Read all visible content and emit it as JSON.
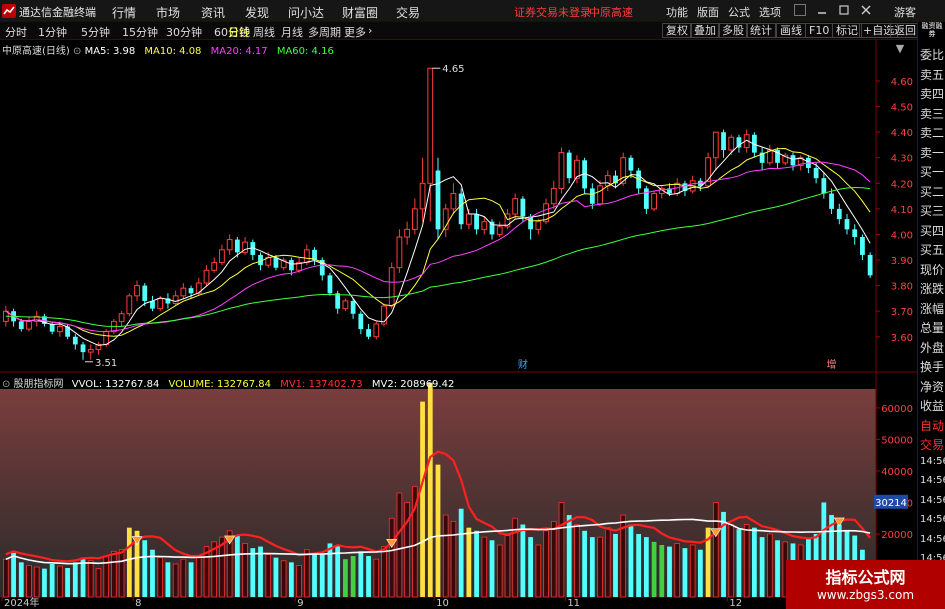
{
  "menubar": {
    "app_title": "通达信金融终端",
    "items": [
      "行情",
      "市场",
      "资讯",
      "发现",
      "问小达",
      "财富圈",
      "交易"
    ],
    "notice": "证券交易未登录",
    "stock_name": "中原高速",
    "right_items": [
      "功能",
      "版面",
      "公式",
      "选项"
    ],
    "guest": "游客"
  },
  "toolbar": {
    "periods": [
      "分时",
      "1分钟",
      "5分钟",
      "15分钟",
      "30分钟",
      "60分钟",
      "日线",
      "周线",
      "月线",
      "多周期",
      "更多"
    ],
    "active_period": "日线",
    "buttons": [
      "复权",
      "叠加",
      "多股",
      "统计",
      "画线",
      "F10",
      "标记",
      "+自选",
      "返回"
    ]
  },
  "right_panel": {
    "icon_text": "融资融券",
    "items": [
      "委比",
      "卖五",
      "卖四",
      "卖三",
      "卖二",
      "卖一",
      "买一",
      "买二",
      "买三",
      "买四",
      "买五",
      "现价",
      "涨跌",
      "涨幅",
      "总量",
      "外盘",
      "换手",
      "净资",
      "收益",
      "自动",
      "交易",
      "14:56",
      "14:56",
      "14:56",
      "14:56",
      "14:56",
      "14:56",
      "14:56"
    ]
  },
  "price_info": {
    "title": "中原高速(日线)",
    "ma5": "MA5: 3.98",
    "ma10": "MA10: 4.08",
    "ma20": "MA20: 4.17",
    "ma60": "MA60: 4.16",
    "high_label": "4.65",
    "low_label": "3.51",
    "event_1": "财",
    "event_2": "增"
  },
  "volume_info": {
    "title": "股朋指标网",
    "vvol": "VVOL: 132767.84",
    "volume": "VOLUME: 132767.84",
    "mv1": "MV1: 137402.73",
    "mv2": "MV2: 208969.42",
    "current_marker": "30214"
  },
  "colors": {
    "up": "#ff3c3c",
    "down": "#54ffff",
    "ma5": "#ffffff",
    "ma10": "#ffff40",
    "ma20": "#ff40ff",
    "ma60": "#40ff40",
    "mv1": "#ff2020",
    "mv2": "#ffffff"
  },
  "chart_data": {
    "type": "candlestick",
    "xlabels": [
      {
        "i": 0,
        "label": "2024年"
      },
      {
        "i": 17,
        "label": "8"
      },
      {
        "i": 38,
        "label": "9"
      },
      {
        "i": 56,
        "label": "10"
      },
      {
        "i": 73,
        "label": "11"
      },
      {
        "i": 94,
        "label": "12"
      }
    ],
    "price_ticks": [
      4.6,
      4.5,
      4.4,
      4.3,
      4.2,
      4.1,
      4.0,
      3.9,
      3.8,
      3.7,
      3.6
    ],
    "price_ylim": [
      3.47,
      4.69
    ],
    "volume_ticks": [
      60000,
      50000,
      40000,
      30000,
      20000,
      10000
    ],
    "volume_ylim": [
      0,
      66000
    ],
    "bars": [
      [
        3.66,
        3.7,
        3.72,
        3.64,
        12000
      ],
      [
        3.7,
        3.66,
        3.71,
        3.64,
        14000
      ],
      [
        3.66,
        3.63,
        3.67,
        3.62,
        11000
      ],
      [
        3.63,
        3.66,
        3.68,
        3.62,
        10000
      ],
      [
        3.66,
        3.68,
        3.7,
        3.64,
        9500
      ],
      [
        3.68,
        3.65,
        3.69,
        3.64,
        9000
      ],
      [
        3.65,
        3.62,
        3.66,
        3.61,
        10500
      ],
      [
        3.62,
        3.64,
        3.66,
        3.6,
        9800
      ],
      [
        3.64,
        3.6,
        3.65,
        3.59,
        9200
      ],
      [
        3.6,
        3.57,
        3.61,
        3.55,
        11000
      ],
      [
        3.57,
        3.54,
        3.58,
        3.51,
        12500
      ],
      [
        3.54,
        3.55,
        3.57,
        3.51,
        11500
      ],
      [
        3.55,
        3.57,
        3.58,
        3.53,
        9000
      ],
      [
        3.57,
        3.62,
        3.63,
        3.56,
        13000
      ],
      [
        3.62,
        3.66,
        3.67,
        3.61,
        14500
      ],
      [
        3.66,
        3.69,
        3.7,
        3.64,
        15000
      ],
      [
        3.69,
        3.76,
        3.77,
        3.68,
        22000
      ],
      [
        3.76,
        3.8,
        3.82,
        3.74,
        21000
      ],
      [
        3.8,
        3.74,
        3.81,
        3.72,
        18000
      ],
      [
        3.74,
        3.71,
        3.76,
        3.7,
        15000
      ],
      [
        3.71,
        3.75,
        3.76,
        3.7,
        12500
      ],
      [
        3.75,
        3.73,
        3.77,
        3.71,
        11000
      ],
      [
        3.73,
        3.76,
        3.78,
        3.72,
        10500
      ],
      [
        3.76,
        3.79,
        3.81,
        3.75,
        12000
      ],
      [
        3.79,
        3.77,
        3.8,
        3.75,
        11000
      ],
      [
        3.77,
        3.81,
        3.83,
        3.76,
        13000
      ],
      [
        3.81,
        3.86,
        3.88,
        3.8,
        16000
      ],
      [
        3.86,
        3.89,
        3.91,
        3.85,
        17500
      ],
      [
        3.89,
        3.94,
        3.96,
        3.88,
        19000
      ],
      [
        3.94,
        3.98,
        4.0,
        3.92,
        21000
      ],
      [
        3.98,
        3.93,
        3.99,
        3.91,
        19500
      ],
      [
        3.93,
        3.97,
        3.99,
        3.92,
        17000
      ],
      [
        3.97,
        3.92,
        3.98,
        3.9,
        15500
      ],
      [
        3.92,
        3.88,
        3.93,
        3.86,
        16000
      ],
      [
        3.88,
        3.91,
        3.93,
        3.87,
        13500
      ],
      [
        3.91,
        3.87,
        3.92,
        3.86,
        12500
      ],
      [
        3.87,
        3.9,
        3.91,
        3.86,
        11500
      ],
      [
        3.9,
        3.86,
        3.91,
        3.84,
        11000
      ],
      [
        3.86,
        3.89,
        3.91,
        3.85,
        10000
      ],
      [
        3.89,
        3.94,
        3.96,
        3.88,
        15000
      ],
      [
        3.94,
        3.9,
        3.95,
        3.88,
        14000
      ],
      [
        3.9,
        3.84,
        3.91,
        3.82,
        13500
      ],
      [
        3.84,
        3.77,
        3.85,
        3.76,
        17000
      ],
      [
        3.77,
        3.71,
        3.78,
        3.69,
        16500
      ],
      [
        3.71,
        3.74,
        3.75,
        3.7,
        12000
      ],
      [
        3.74,
        3.69,
        3.75,
        3.67,
        13000
      ],
      [
        3.69,
        3.63,
        3.7,
        3.61,
        14500
      ],
      [
        3.63,
        3.6,
        3.65,
        3.59,
        13000
      ],
      [
        3.6,
        3.65,
        3.66,
        3.59,
        12000
      ],
      [
        3.65,
        3.72,
        3.73,
        3.64,
        16000
      ],
      [
        3.72,
        3.87,
        3.89,
        3.71,
        25000
      ],
      [
        3.87,
        3.99,
        4.02,
        3.85,
        33000
      ],
      [
        3.99,
        4.02,
        4.05,
        3.96,
        30000
      ],
      [
        4.02,
        4.1,
        4.14,
        4.0,
        35000
      ],
      [
        4.1,
        4.2,
        4.3,
        4.05,
        62000
      ],
      [
        4.2,
        4.65,
        4.65,
        4.05,
        68000
      ],
      [
        4.25,
        4.02,
        4.3,
        3.98,
        42000
      ],
      [
        4.02,
        4.1,
        4.12,
        3.99,
        26000
      ],
      [
        4.1,
        4.16,
        4.2,
        4.08,
        24000
      ],
      [
        4.16,
        4.04,
        4.18,
        4.02,
        28000
      ],
      [
        4.04,
        4.08,
        4.1,
        4.02,
        22000
      ],
      [
        4.08,
        4.02,
        4.1,
        4.0,
        21000
      ],
      [
        4.02,
        4.05,
        4.07,
        4.0,
        19000
      ],
      [
        4.05,
        4.0,
        4.06,
        3.98,
        18000
      ],
      [
        4.0,
        4.03,
        4.05,
        3.99,
        16500
      ],
      [
        4.03,
        4.08,
        4.1,
        4.02,
        19500
      ],
      [
        4.08,
        4.14,
        4.16,
        4.06,
        25000
      ],
      [
        4.14,
        4.07,
        4.15,
        4.05,
        23000
      ],
      [
        4.07,
        4.02,
        4.08,
        3.98,
        19000
      ],
      [
        4.02,
        4.05,
        4.06,
        4.0,
        16500
      ],
      [
        4.05,
        4.12,
        4.14,
        4.04,
        21000
      ],
      [
        4.12,
        4.18,
        4.21,
        4.1,
        24000
      ],
      [
        4.18,
        4.32,
        4.34,
        4.16,
        30000
      ],
      [
        4.32,
        4.22,
        4.33,
        4.2,
        26000
      ],
      [
        4.22,
        4.29,
        4.31,
        4.2,
        23000
      ],
      [
        4.29,
        4.18,
        4.3,
        4.16,
        21000
      ],
      [
        4.18,
        4.12,
        4.2,
        4.1,
        19000
      ],
      [
        4.12,
        4.19,
        4.21,
        4.11,
        19000
      ],
      [
        4.19,
        4.23,
        4.25,
        4.17,
        22000
      ],
      [
        4.23,
        4.2,
        4.25,
        4.18,
        20000
      ],
      [
        4.2,
        4.3,
        4.32,
        4.19,
        26000
      ],
      [
        4.3,
        4.25,
        4.31,
        4.22,
        23000
      ],
      [
        4.25,
        4.18,
        4.26,
        4.16,
        20000
      ],
      [
        4.18,
        4.1,
        4.19,
        4.08,
        19000
      ],
      [
        4.1,
        4.16,
        4.17,
        4.09,
        17500
      ],
      [
        4.16,
        4.18,
        4.19,
        4.14,
        16500
      ],
      [
        4.18,
        4.16,
        4.2,
        4.15,
        16000
      ],
      [
        4.16,
        4.2,
        4.22,
        4.15,
        17000
      ],
      [
        4.2,
        4.17,
        4.21,
        4.15,
        15500
      ],
      [
        4.17,
        4.21,
        4.23,
        4.16,
        16500
      ],
      [
        4.21,
        4.19,
        4.22,
        4.17,
        15000
      ],
      [
        4.19,
        4.3,
        4.32,
        4.18,
        22000
      ],
      [
        4.3,
        4.4,
        4.4,
        4.25,
        30000
      ],
      [
        4.4,
        4.33,
        4.41,
        4.3,
        27000
      ],
      [
        4.33,
        4.38,
        4.39,
        4.31,
        23000
      ],
      [
        4.38,
        4.34,
        4.39,
        4.32,
        21500
      ],
      [
        4.34,
        4.39,
        4.41,
        4.32,
        23000
      ],
      [
        4.39,
        4.32,
        4.4,
        4.3,
        22000
      ],
      [
        4.32,
        4.28,
        4.34,
        4.25,
        19000
      ],
      [
        4.28,
        4.33,
        4.35,
        4.27,
        20000
      ],
      [
        4.33,
        4.28,
        4.34,
        4.26,
        18000
      ],
      [
        4.28,
        4.31,
        4.32,
        4.27,
        17500
      ],
      [
        4.31,
        4.27,
        4.32,
        4.25,
        17000
      ],
      [
        4.27,
        4.3,
        4.31,
        4.25,
        16500
      ],
      [
        4.3,
        4.26,
        4.31,
        4.24,
        18500
      ],
      [
        4.26,
        4.22,
        4.28,
        4.2,
        20000
      ],
      [
        4.22,
        4.16,
        4.24,
        4.14,
        30000
      ],
      [
        4.16,
        4.1,
        4.18,
        4.08,
        26000
      ],
      [
        4.1,
        4.06,
        4.12,
        4.04,
        23000
      ],
      [
        4.06,
        4.02,
        4.08,
        4.0,
        21000
      ],
      [
        4.02,
        3.99,
        4.04,
        3.96,
        19500
      ],
      [
        3.99,
        3.92,
        4.0,
        3.9,
        15000
      ],
      [
        3.92,
        3.84,
        3.93,
        3.83,
        10000
      ]
    ],
    "yellow_volume_bars": [
      16,
      17,
      54,
      55,
      56,
      60,
      91
    ],
    "green_volume_bars": [
      44,
      45,
      84,
      85
    ],
    "signal_markers": [
      17,
      29,
      50,
      92,
      108,
      117
    ]
  }
}
